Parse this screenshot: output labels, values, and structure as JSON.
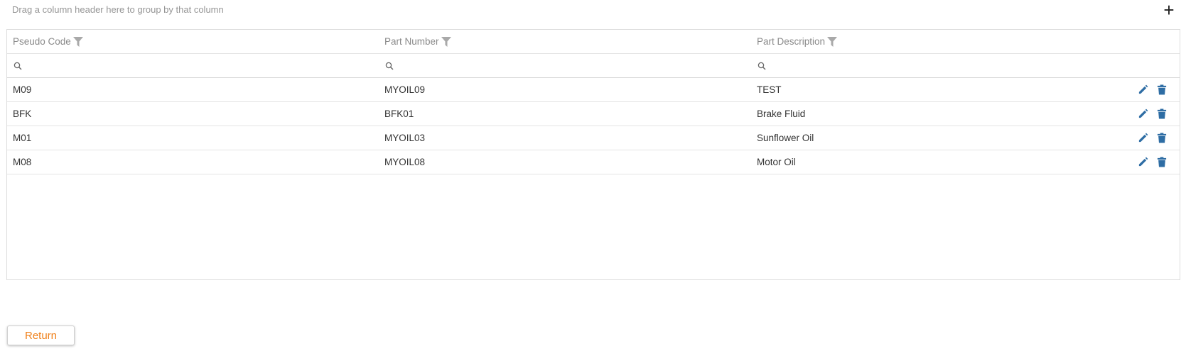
{
  "group_panel": {
    "hint": "Drag a column header here to group by that column",
    "add_icon": "plus-icon"
  },
  "columns": [
    {
      "label": "Pseudo Code"
    },
    {
      "label": "Part Number"
    },
    {
      "label": "Part Description"
    }
  ],
  "rows": [
    {
      "pseudo_code": "M09",
      "part_number": "MYOIL09",
      "part_description": "TEST"
    },
    {
      "pseudo_code": "BFK",
      "part_number": "BFK01",
      "part_description": "Brake Fluid"
    },
    {
      "pseudo_code": "M01",
      "part_number": "MYOIL03",
      "part_description": "Sunflower Oil"
    },
    {
      "pseudo_code": "M08",
      "part_number": "MYOIL08",
      "part_description": "Motor Oil"
    }
  ],
  "colors": {
    "action_icon": "#2e6da4",
    "return_text": "#f0801a",
    "header_text": "#8a8a8a"
  },
  "footer": {
    "return_label": "Return"
  }
}
